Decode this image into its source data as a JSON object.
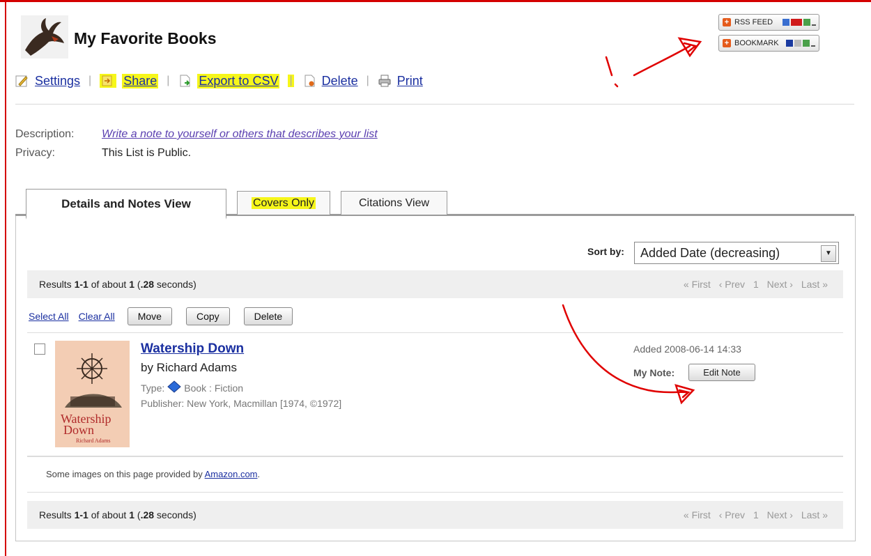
{
  "header": {
    "title": "My Favorite Books",
    "rss_label": "RSS FEED",
    "bookmark_label": "BOOKMARK"
  },
  "toolbar": {
    "settings": "Settings",
    "share": "Share",
    "export": "Export to CSV",
    "delete": "Delete",
    "print": "Print",
    "separator": "|"
  },
  "meta": {
    "description_label": "Description:",
    "description_value": "Write a note to yourself or others that describes your list",
    "privacy_label": "Privacy:",
    "privacy_value": "This List is Public."
  },
  "tabs": [
    {
      "label": "Details and Notes View"
    },
    {
      "label": "Covers Only"
    },
    {
      "label": "Citations View"
    }
  ],
  "sort": {
    "label": "Sort by:",
    "value": "Added Date (decreasing)"
  },
  "results": {
    "prefix": "Results ",
    "range": "1-1",
    "middle": " of about ",
    "count": "1",
    "open": " (",
    "time": ".28",
    "suffix": " seconds)"
  },
  "pager": {
    "first": "« First",
    "prev": "‹ Prev",
    "page": "1",
    "next": "Next ›",
    "last": "Last »"
  },
  "list_actions": {
    "select_all": "Select All",
    "clear_all": "Clear All",
    "move": "Move",
    "copy": "Copy",
    "delete": "Delete"
  },
  "item": {
    "title": "Watership Down",
    "author": "by Richard Adams",
    "type_label": "Type:",
    "type_value": "Book : Fiction",
    "publisher": "Publisher: New York, Macmillan [1974, ©1972]",
    "added": "Added 2008-06-14 14:33",
    "note_label": "My Note:",
    "edit_note": "Edit Note",
    "cover_line1": "Watership",
    "cover_line2": "Down",
    "cover_author": "Richard Adams"
  },
  "footer": {
    "amazon_text": "Some images on this page provided by ",
    "amazon_link": "Amazon.com",
    "amazon_end": "."
  },
  "colors": {
    "annotation_red": "#e00000",
    "highlight_yellow": "#f6f61a",
    "link_blue": "#1a2fa0"
  }
}
